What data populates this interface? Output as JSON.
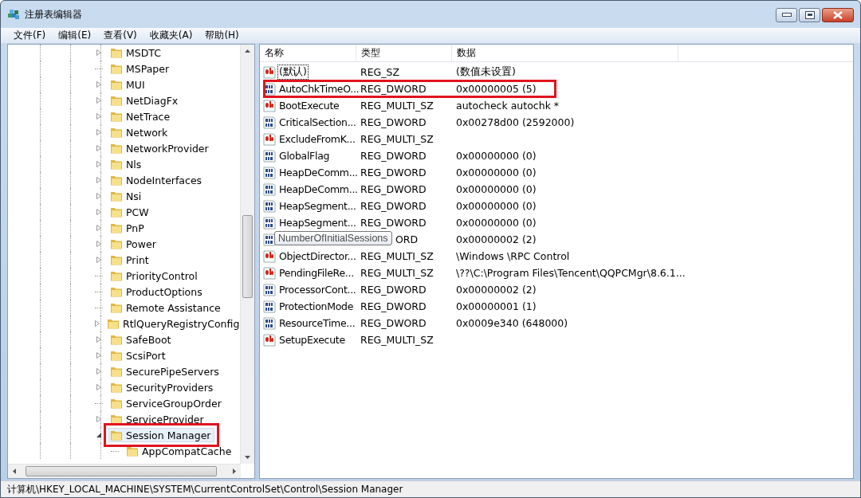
{
  "window": {
    "title": "注册表编辑器"
  },
  "menu": [
    "文件(F)",
    "编辑(E)",
    "查看(V)",
    "收藏夹(A)",
    "帮助(H)"
  ],
  "tree": [
    {
      "label": "MSDTC",
      "expandable": true,
      "expanded": false,
      "selected": false,
      "highlighted": false
    },
    {
      "label": "MSPaper",
      "expandable": false,
      "selected": false,
      "highlighted": false
    },
    {
      "label": "MUI",
      "expandable": true,
      "expanded": false,
      "selected": false,
      "highlighted": false
    },
    {
      "label": "NetDiagFx",
      "expandable": true,
      "expanded": false,
      "selected": false,
      "highlighted": false
    },
    {
      "label": "NetTrace",
      "expandable": true,
      "expanded": false,
      "selected": false,
      "highlighted": false
    },
    {
      "label": "Network",
      "expandable": true,
      "expanded": false,
      "selected": false,
      "highlighted": false
    },
    {
      "label": "NetworkProvider",
      "expandable": true,
      "expanded": false,
      "selected": false,
      "highlighted": false
    },
    {
      "label": "Nls",
      "expandable": true,
      "expanded": false,
      "selected": false,
      "highlighted": false
    },
    {
      "label": "NodeInterfaces",
      "expandable": true,
      "expanded": false,
      "selected": false,
      "highlighted": false
    },
    {
      "label": "Nsi",
      "expandable": true,
      "expanded": false,
      "selected": false,
      "highlighted": false
    },
    {
      "label": "PCW",
      "expandable": true,
      "expanded": false,
      "selected": false,
      "highlighted": false
    },
    {
      "label": "PnP",
      "expandable": true,
      "expanded": false,
      "selected": false,
      "highlighted": false
    },
    {
      "label": "Power",
      "expandable": true,
      "expanded": false,
      "selected": false,
      "highlighted": false
    },
    {
      "label": "Print",
      "expandable": true,
      "expanded": false,
      "selected": false,
      "highlighted": false
    },
    {
      "label": "PriorityControl",
      "expandable": false,
      "selected": false,
      "highlighted": false
    },
    {
      "label": "ProductOptions",
      "expandable": false,
      "selected": false,
      "highlighted": false
    },
    {
      "label": "Remote Assistance",
      "expandable": false,
      "selected": false,
      "highlighted": false
    },
    {
      "label": "RtlQueryRegistryConfig",
      "expandable": true,
      "expanded": false,
      "selected": false,
      "highlighted": false
    },
    {
      "label": "SafeBoot",
      "expandable": true,
      "expanded": false,
      "selected": false,
      "highlighted": false
    },
    {
      "label": "ScsiPort",
      "expandable": true,
      "expanded": false,
      "selected": false,
      "highlighted": false
    },
    {
      "label": "SecurePipeServers",
      "expandable": true,
      "expanded": false,
      "selected": false,
      "highlighted": false
    },
    {
      "label": "SecurityProviders",
      "expandable": true,
      "expanded": false,
      "selected": false,
      "highlighted": false
    },
    {
      "label": "ServiceGroupOrder",
      "expandable": false,
      "selected": false,
      "highlighted": false
    },
    {
      "label": "ServiceProvider",
      "expandable": true,
      "expanded": false,
      "selected": false,
      "highlighted": false
    },
    {
      "label": "Session Manager",
      "expandable": true,
      "expanded": true,
      "selected": true,
      "highlighted": true,
      "children": [
        {
          "label": "AppCompatCache",
          "expandable": false,
          "selected": false,
          "highlighted": false
        }
      ]
    }
  ],
  "list": {
    "columns": [
      "名称",
      "类型",
      "数据"
    ],
    "rows": [
      {
        "kind": "string",
        "name": "(默认)",
        "type": "REG_SZ",
        "data": "(数值未设置)",
        "focused": true,
        "highlighted": false
      },
      {
        "kind": "binary",
        "name": "AutoChkTimeO...",
        "type": "REG_DWORD",
        "data": "0x00000005 (5)",
        "focused": false,
        "highlighted": true
      },
      {
        "kind": "string",
        "name": "BootExecute",
        "type": "REG_MULTI_SZ",
        "data": "autocheck autochk *",
        "focused": false,
        "highlighted": false
      },
      {
        "kind": "binary",
        "name": "CriticalSection...",
        "type": "REG_DWORD",
        "data": "0x00278d00 (2592000)",
        "focused": false,
        "highlighted": false
      },
      {
        "kind": "string",
        "name": "ExcludeFromK...",
        "type": "REG_MULTI_SZ",
        "focused": false,
        "highlighted": false
      },
      {
        "kind": "binary",
        "name": "GlobalFlag",
        "type": "REG_DWORD",
        "data": "0x00000000 (0)",
        "focused": false,
        "highlighted": false
      },
      {
        "kind": "binary",
        "name": "HeapDeComm...",
        "type": "REG_DWORD",
        "data": "0x00000000 (0)",
        "focused": false,
        "highlighted": false
      },
      {
        "kind": "binary",
        "name": "HeapDeComm...",
        "type": "REG_DWORD",
        "data": "0x00000000 (0)",
        "focused": false,
        "highlighted": false
      },
      {
        "kind": "binary",
        "name": "HeapSegment...",
        "type": "REG_DWORD",
        "data": "0x00000000 (0)",
        "focused": false,
        "highlighted": false
      },
      {
        "kind": "binary",
        "name": "HeapSegment...",
        "type": "REG_DWORD",
        "data": "0x00000000 (0)",
        "focused": false,
        "highlighted": false
      },
      {
        "kind": "binary",
        "type_visible": "ORD",
        "data": "0x00000002 (2)",
        "highlighted": false,
        "tooltip": "NumberOfInitialSessions"
      },
      {
        "kind": "string",
        "name": "ObjectDirector...",
        "type": "REG_MULTI_SZ",
        "data": "\\Windows \\RPC Control",
        "focused": false,
        "highlighted": false
      },
      {
        "kind": "string",
        "name": "PendingFileRe...",
        "type": "REG_MULTI_SZ",
        "data": "\\??\\C:\\Program Files\\Tencent\\QQPCMgr\\8.6.1...",
        "focused": false,
        "highlighted": false
      },
      {
        "kind": "binary",
        "name": "ProcessorCont...",
        "type": "REG_DWORD",
        "data": "0x00000002 (2)",
        "focused": false,
        "highlighted": false
      },
      {
        "kind": "binary",
        "name": "ProtectionMode",
        "type": "REG_DWORD",
        "data": "0x00000001 (1)",
        "focused": false,
        "highlighted": false
      },
      {
        "kind": "binary",
        "name": "ResourceTime...",
        "type": "REG_DWORD",
        "data": "0x0009e340 (648000)",
        "focused": false,
        "highlighted": false
      },
      {
        "kind": "string",
        "name": "SetupExecute",
        "type": "REG_MULTI_SZ",
        "focused": false,
        "highlighted": false
      }
    ]
  },
  "status_bar": "计算机\\HKEY_LOCAL_MACHINE\\SYSTEM\\CurrentControlSet\\Control\\Session Manager"
}
